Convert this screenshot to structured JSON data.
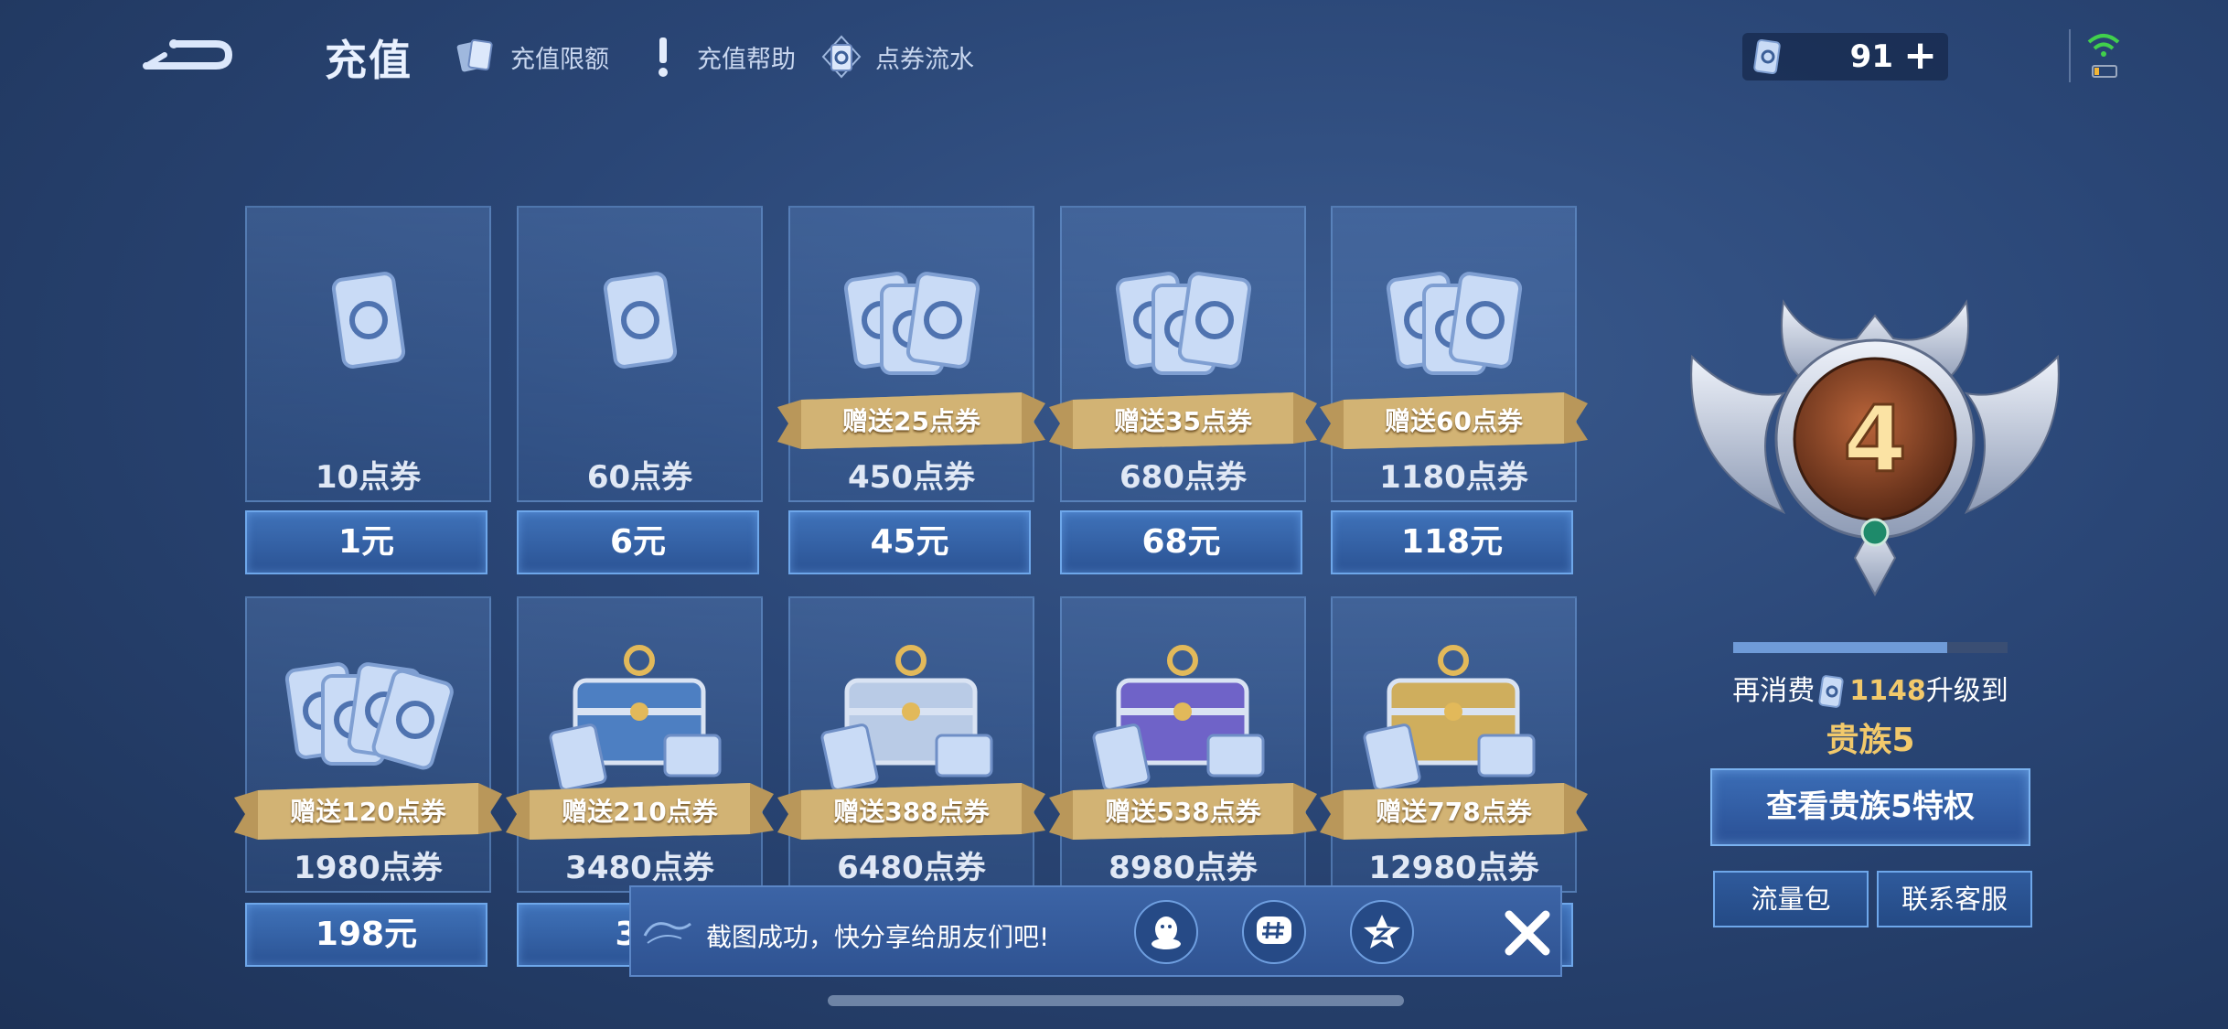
{
  "header": {
    "title": "充值",
    "links": [
      {
        "label": "充值限额",
        "icon": "cards-icon"
      },
      {
        "label": "充值帮助",
        "icon": "exclamation-icon"
      },
      {
        "label": "点券流水",
        "icon": "coupon-icon"
      }
    ],
    "balance": "91",
    "balance_plus": "+"
  },
  "packages": [
    {
      "amount": "10点券",
      "price": "1元",
      "bonus": ""
    },
    {
      "amount": "60点券",
      "price": "6元",
      "bonus": ""
    },
    {
      "amount": "450点券",
      "price": "45元",
      "bonus": "赠送25点券"
    },
    {
      "amount": "680点券",
      "price": "68元",
      "bonus": "赠送35点券"
    },
    {
      "amount": "1180点券",
      "price": "118元",
      "bonus": "赠送60点券"
    },
    {
      "amount": "1980点券",
      "price": "198元",
      "bonus": "赠送120点券"
    },
    {
      "amount": "3480点券",
      "price": "34",
      "bonus": "赠送210点券"
    },
    {
      "amount": "6480点券",
      "price": "",
      "bonus": "赠送388点券"
    },
    {
      "amount": "8980点券",
      "price": "",
      "bonus": "赠送538点券"
    },
    {
      "amount": "12980点券",
      "price": "",
      "bonus": "赠送778点券"
    }
  ],
  "noble": {
    "level": "4",
    "progress": 0.78,
    "upgrade_prefix": "再消费",
    "upgrade_amount": "1148",
    "upgrade_suffix": "升级到",
    "next_level": "贵族5",
    "privilege_button": "查看贵族5特权",
    "traffic_button": "流量包",
    "support_button": "联系客服"
  },
  "toast": {
    "message": "截图成功，快分享给朋友们吧!",
    "share_targets": [
      "qq-icon",
      "hashtag-icon",
      "qzone-icon"
    ]
  },
  "colors": {
    "background": "#2a4676",
    "accent_gold": "#f2c96b",
    "price_button": "#2b5394"
  }
}
